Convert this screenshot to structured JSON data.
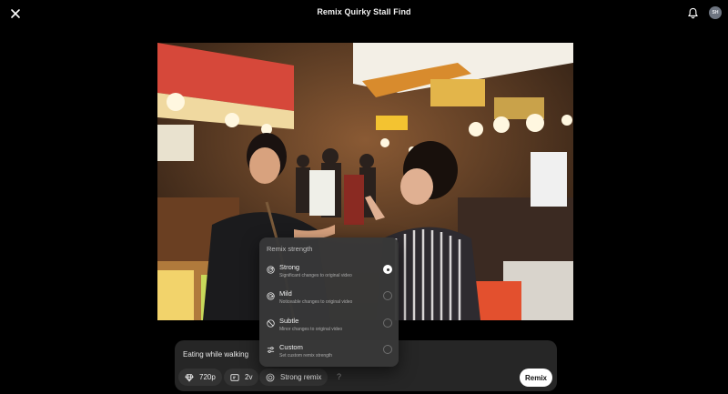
{
  "header": {
    "title": "Remix Quirky Stall Find",
    "close_icon": "close-icon",
    "bell_icon": "bell-icon",
    "avatar_initials": "SH"
  },
  "media": {
    "description_visible": false
  },
  "prompt": {
    "text": "Eating while walking",
    "resolution": "720p",
    "variations": "2v",
    "strength": "Strong remix",
    "help": "?",
    "submit_label": "Remix"
  },
  "strength_menu": {
    "header": "Remix strength",
    "options": [
      {
        "label": "Strong",
        "desc": "Significant changes to original video",
        "icon": "strong-dial-icon",
        "selected": true
      },
      {
        "label": "Mild",
        "desc": "Noticeable changes to original video",
        "icon": "mild-dial-icon",
        "selected": false
      },
      {
        "label": "Subtle",
        "desc": "Minor changes to original video",
        "icon": "subtle-dial-icon",
        "selected": false
      },
      {
        "label": "Custom",
        "desc": "Set custom remix strength",
        "icon": "sliders-icon",
        "selected": false
      }
    ]
  },
  "colors": {
    "background": "#000000",
    "panel": "#262626",
    "menu": "#383838",
    "accent": "#ffffff"
  }
}
